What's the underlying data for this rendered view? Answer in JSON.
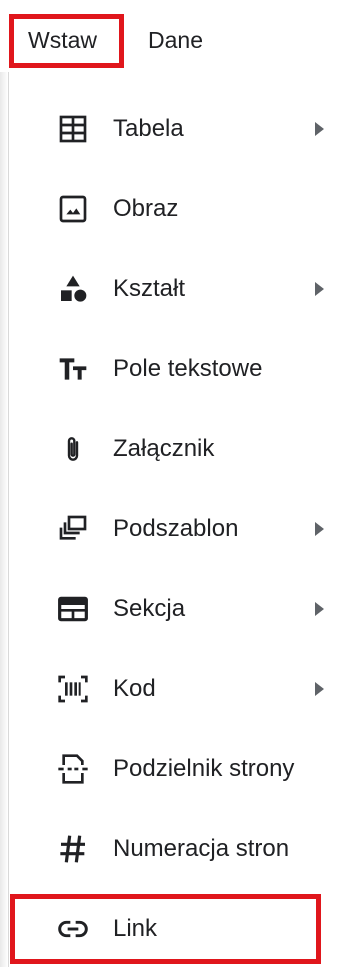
{
  "menubar": {
    "tabs": [
      {
        "label": "Wstaw",
        "highlighted": true
      },
      {
        "label": "Dane",
        "highlighted": false
      }
    ]
  },
  "menu": {
    "items": [
      {
        "label": "Tabela",
        "icon": "table-icon",
        "submenu": true
      },
      {
        "label": "Obraz",
        "icon": "image-icon",
        "submenu": false
      },
      {
        "label": "Kształt",
        "icon": "shapes-icon",
        "submenu": true
      },
      {
        "label": "Pole tekstowe",
        "icon": "text-field-icon",
        "submenu": false
      },
      {
        "label": "Załącznik",
        "icon": "attachment-icon",
        "submenu": false
      },
      {
        "label": "Podszablon",
        "icon": "subtemplate-icon",
        "submenu": true
      },
      {
        "label": "Sekcja",
        "icon": "section-icon",
        "submenu": true
      },
      {
        "label": "Kod",
        "icon": "barcode-icon",
        "submenu": true
      },
      {
        "label": "Podzielnik strony",
        "icon": "page-break-icon",
        "submenu": false
      },
      {
        "label": "Numeracja stron",
        "icon": "hash-icon",
        "submenu": false
      },
      {
        "label": "Link",
        "icon": "link-icon",
        "submenu": false,
        "highlighted": true
      }
    ]
  },
  "colors": {
    "highlight": "#e0161c",
    "text": "#202124",
    "icon": "#202124",
    "arrow": "#5f6368"
  }
}
